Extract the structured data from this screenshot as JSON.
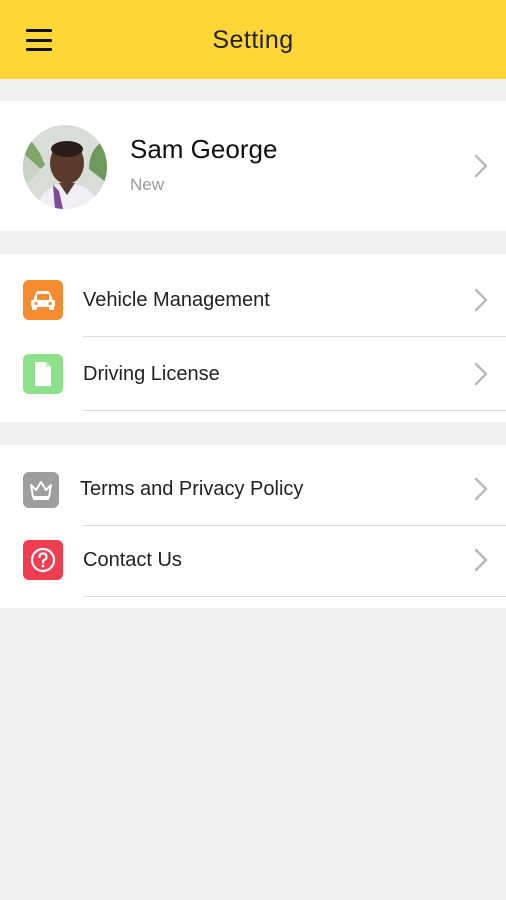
{
  "header": {
    "title": "Setting",
    "menu_icon": "hamburger-menu-icon",
    "background": "#fed636"
  },
  "profile": {
    "name": "Sam George",
    "status": "New"
  },
  "section_vehicle": {
    "items": [
      {
        "label": "Vehicle Management",
        "icon": "car-icon",
        "icon_color": "#f78b2f"
      },
      {
        "label": "Driving License",
        "icon": "document-icon",
        "icon_color": "#8ee08a"
      }
    ]
  },
  "section_info": {
    "items": [
      {
        "label": "Terms and Privacy Policy",
        "icon": "crown-icon",
        "icon_color": "#9e9e9e"
      },
      {
        "label": "Contact Us",
        "icon": "help-circle-icon",
        "icon_color": "#ef3e52"
      }
    ]
  }
}
